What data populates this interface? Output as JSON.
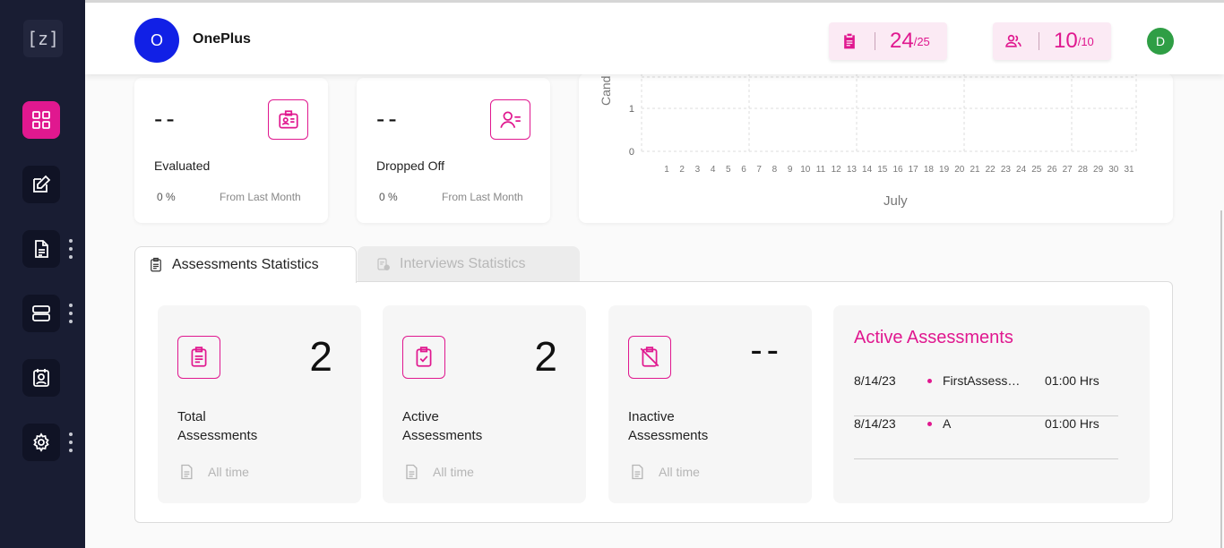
{
  "sidebar": {
    "logo": "[z]",
    "items": [
      {
        "name": "dashboard"
      },
      {
        "name": "edit"
      },
      {
        "name": "documents"
      },
      {
        "name": "servers"
      },
      {
        "name": "profile"
      },
      {
        "name": "settings"
      }
    ]
  },
  "header": {
    "org_initial": "O",
    "org_name": "OnePlus",
    "assessments_used": "24",
    "assessments_total": "/25",
    "users_used": "10",
    "users_total": "/10",
    "user_initial": "D"
  },
  "cards": [
    {
      "value": "--",
      "label": "Evaluated",
      "percent": "0 %",
      "from": "From Last Month"
    },
    {
      "value": "--",
      "label": "Dropped Off",
      "percent": "0 %",
      "from": "From Last Month"
    }
  ],
  "chart_data": {
    "type": "bar",
    "ylabel": "Cand",
    "xlabel": "July",
    "categories": [
      "1",
      "2",
      "3",
      "4",
      "5",
      "6",
      "7",
      "8",
      "9",
      "10",
      "11",
      "12",
      "13",
      "14",
      "15",
      "16",
      "17",
      "18",
      "19",
      "20",
      "21",
      "22",
      "23",
      "24",
      "25",
      "26",
      "27",
      "28",
      "29",
      "30",
      "31"
    ],
    "y_ticks": [
      "0",
      "1"
    ],
    "grid": true
  },
  "tabs": {
    "assessments": "Assessments Statistics",
    "interviews": "Interviews Statistics"
  },
  "stats": [
    {
      "value": "2",
      "title_line1": "Total",
      "title_line2": "Assessments",
      "period": "All time"
    },
    {
      "value": "2",
      "title_line1": "Active",
      "title_line2": "Assessments",
      "period": "All time"
    },
    {
      "value": "--",
      "title_line1": "Inactive",
      "title_line2": "Assessments",
      "period": "All time"
    }
  ],
  "active_assessments": {
    "title": "Active Assessments",
    "rows": [
      {
        "date": "8/14/23",
        "name": "FirstAssessment",
        "duration": "01:00 Hrs"
      },
      {
        "date": "8/14/23",
        "name": "A",
        "duration": "01:00 Hrs"
      }
    ]
  },
  "colors": {
    "accent": "#e0188f",
    "sidebar": "#191d33",
    "org_avatar": "#1120e6",
    "user_avatar": "#2f9e45"
  }
}
